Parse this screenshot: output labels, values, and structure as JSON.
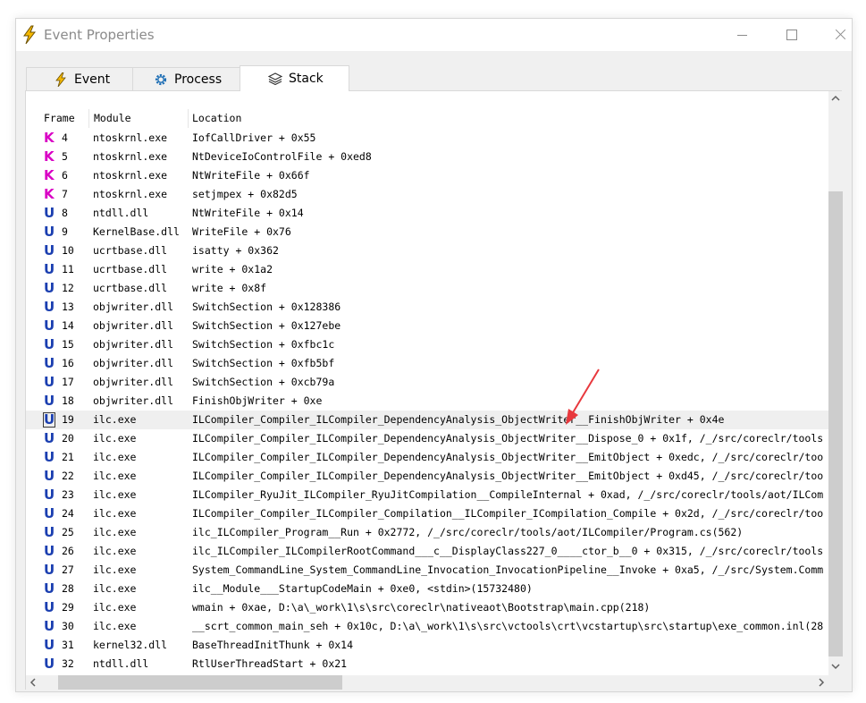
{
  "window": {
    "title": "Event Properties",
    "accent": "#f5b800"
  },
  "tabs": [
    {
      "label": "Event",
      "icon": "lightning-icon"
    },
    {
      "label": "Process",
      "icon": "gear-icon"
    },
    {
      "label": "Stack",
      "icon": "layers-icon",
      "selected": true
    }
  ],
  "columns": [
    "Frame",
    "Module",
    "Location"
  ],
  "rows": [
    {
      "type": "K",
      "frame": "4",
      "module": "ntoskrnl.exe",
      "location": "IofCallDriver + 0x55"
    },
    {
      "type": "K",
      "frame": "5",
      "module": "ntoskrnl.exe",
      "location": "NtDeviceIoControlFile + 0xed8"
    },
    {
      "type": "K",
      "frame": "6",
      "module": "ntoskrnl.exe",
      "location": "NtWriteFile + 0x66f"
    },
    {
      "type": "K",
      "frame": "7",
      "module": "ntoskrnl.exe",
      "location": "setjmpex + 0x82d5"
    },
    {
      "type": "U",
      "frame": "8",
      "module": "ntdll.dll",
      "location": "NtWriteFile + 0x14"
    },
    {
      "type": "U",
      "frame": "9",
      "module": "KernelBase.dll",
      "location": "WriteFile + 0x76"
    },
    {
      "type": "U",
      "frame": "10",
      "module": "ucrtbase.dll",
      "location": "isatty + 0x362"
    },
    {
      "type": "U",
      "frame": "11",
      "module": "ucrtbase.dll",
      "location": "write + 0x1a2"
    },
    {
      "type": "U",
      "frame": "12",
      "module": "ucrtbase.dll",
      "location": "write + 0x8f"
    },
    {
      "type": "U",
      "frame": "13",
      "module": "objwriter.dll",
      "location": "SwitchSection + 0x128386"
    },
    {
      "type": "U",
      "frame": "14",
      "module": "objwriter.dll",
      "location": "SwitchSection + 0x127ebe"
    },
    {
      "type": "U",
      "frame": "15",
      "module": "objwriter.dll",
      "location": "SwitchSection + 0xfbc1c"
    },
    {
      "type": "U",
      "frame": "16",
      "module": "objwriter.dll",
      "location": "SwitchSection + 0xfb5bf"
    },
    {
      "type": "U",
      "frame": "17",
      "module": "objwriter.dll",
      "location": "SwitchSection + 0xcb79a"
    },
    {
      "type": "U",
      "frame": "18",
      "module": "objwriter.dll",
      "location": "FinishObjWriter + 0xe"
    },
    {
      "type": "U",
      "frame": "19",
      "module": "ilc.exe",
      "location": "ILCompiler_Compiler_ILCompiler_DependencyAnalysis_ObjectWriter__FinishObjWriter + 0x4e",
      "selected": true
    },
    {
      "type": "U",
      "frame": "20",
      "module": "ilc.exe",
      "location": "ILCompiler_Compiler_ILCompiler_DependencyAnalysis_ObjectWriter__Dispose_0 + 0x1f, /_/src/coreclr/tools"
    },
    {
      "type": "U",
      "frame": "21",
      "module": "ilc.exe",
      "location": "ILCompiler_Compiler_ILCompiler_DependencyAnalysis_ObjectWriter__EmitObject + 0xedc, /_/src/coreclr/too"
    },
    {
      "type": "U",
      "frame": "22",
      "module": "ilc.exe",
      "location": "ILCompiler_Compiler_ILCompiler_DependencyAnalysis_ObjectWriter__EmitObject + 0xd45, /_/src/coreclr/too"
    },
    {
      "type": "U",
      "frame": "23",
      "module": "ilc.exe",
      "location": "ILCompiler_RyuJit_ILCompiler_RyuJitCompilation__CompileInternal + 0xad, /_/src/coreclr/tools/aot/ILCom"
    },
    {
      "type": "U",
      "frame": "24",
      "module": "ilc.exe",
      "location": "ILCompiler_Compiler_ILCompiler_Compilation__ILCompiler_ICompilation_Compile + 0x2d, /_/src/coreclr/too"
    },
    {
      "type": "U",
      "frame": "25",
      "module": "ilc.exe",
      "location": "ilc_ILCompiler_Program__Run + 0x2772, /_/src/coreclr/tools/aot/ILCompiler/Program.cs(562)"
    },
    {
      "type": "U",
      "frame": "26",
      "module": "ilc.exe",
      "location": "ilc_ILCompiler_ILCompilerRootCommand___c__DisplayClass227_0____ctor_b__0 + 0x315, /_/src/coreclr/tools"
    },
    {
      "type": "U",
      "frame": "27",
      "module": "ilc.exe",
      "location": "System_CommandLine_System_CommandLine_Invocation_InvocationPipeline__Invoke + 0xa5, /_/src/System.Comm"
    },
    {
      "type": "U",
      "frame": "28",
      "module": "ilc.exe",
      "location": "ilc__Module___StartupCodeMain + 0xe0, <stdin>(15732480)"
    },
    {
      "type": "U",
      "frame": "29",
      "module": "ilc.exe",
      "location": "wmain + 0xae, D:\\a\\_work\\1\\s\\src\\coreclr\\nativeaot\\Bootstrap\\main.cpp(218)"
    },
    {
      "type": "U",
      "frame": "30",
      "module": "ilc.exe",
      "location": "__scrt_common_main_seh + 0x10c, D:\\a\\_work\\1\\s\\src\\vctools\\crt\\vcstartup\\src\\startup\\exe_common.inl(28"
    },
    {
      "type": "U",
      "frame": "31",
      "module": "kernel32.dll",
      "location": "BaseThreadInitThunk + 0x14"
    },
    {
      "type": "U",
      "frame": "32",
      "module": "ntdll.dll",
      "location": "RtlUserThreadStart + 0x21"
    }
  ],
  "colors": {
    "kernel": "#d900c4",
    "user": "#1a3eb0",
    "annotation_arrow": "#e8383d"
  }
}
